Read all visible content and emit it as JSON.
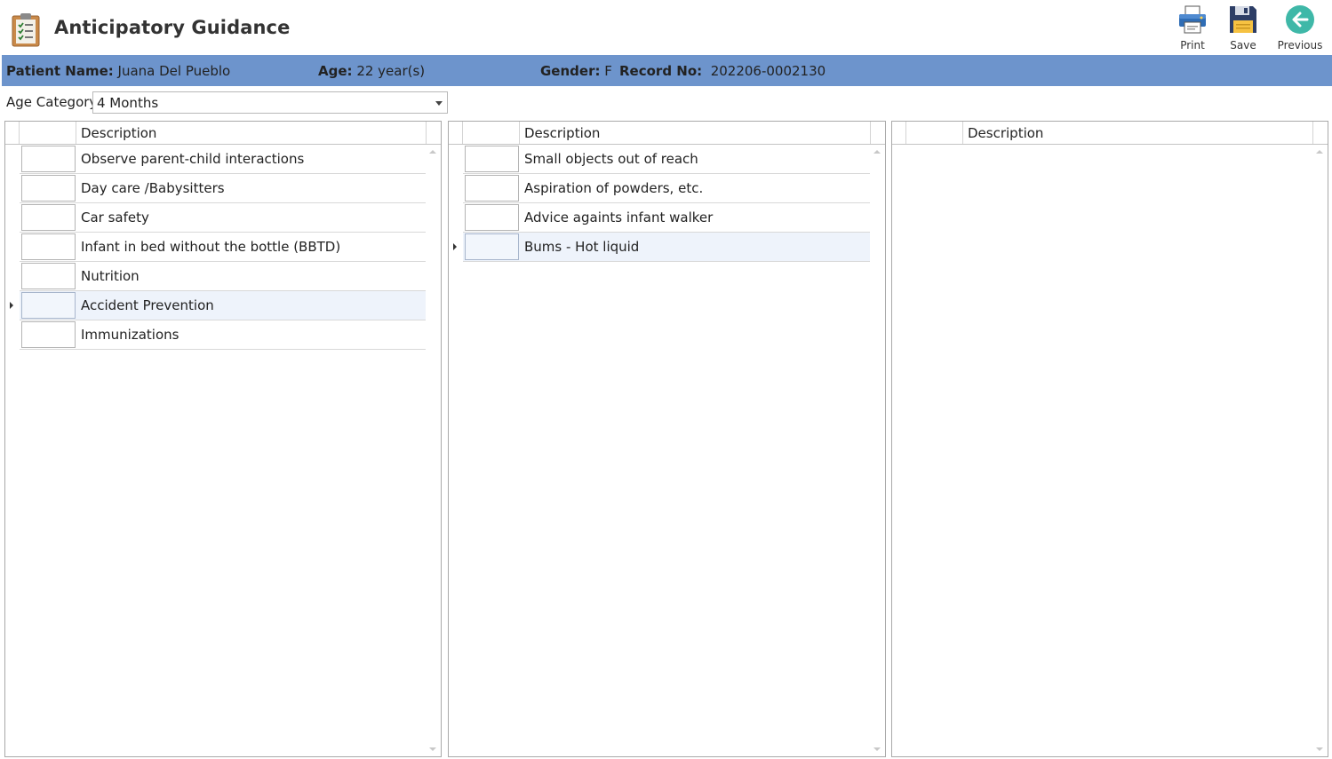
{
  "header": {
    "title": "Anticipatory Guidance",
    "app_icon": "clipboard-checklist-icon",
    "toolbar": {
      "print_label": "Print",
      "save_label": "Save",
      "previous_label": "Previous"
    }
  },
  "patient": {
    "name_label": "Patient Name:",
    "name": "Juana Del Pueblo",
    "age_label": "Age:",
    "age": "22 year(s)",
    "gender_label": "Gender:",
    "gender": "F",
    "record_label": "Record No:",
    "record": "202206-0002130",
    "bar_color": "#6d94cc"
  },
  "age_category": {
    "label": "Age Category:",
    "value": "4 Months"
  },
  "grids": [
    {
      "header": "Description",
      "rows": [
        {
          "desc": "Observe parent-child interactions"
        },
        {
          "desc": "Day care /Babysitters"
        },
        {
          "desc": "Car safety"
        },
        {
          "desc": "Infant in bed without the bottle (BBTD)"
        },
        {
          "desc": "Nutrition"
        },
        {
          "desc": "Accident Prevention"
        },
        {
          "desc": "Immunizations"
        }
      ],
      "current_row": 5
    },
    {
      "header": "Description",
      "rows": [
        {
          "desc": "Small objects out of reach"
        },
        {
          "desc": "Aspiration of powders, etc."
        },
        {
          "desc": "Advice againts infant walker"
        },
        {
          "desc": "Bums - Hot liquid"
        }
      ],
      "current_row": 3
    },
    {
      "header": "Description",
      "rows": [],
      "current_row": null
    }
  ]
}
